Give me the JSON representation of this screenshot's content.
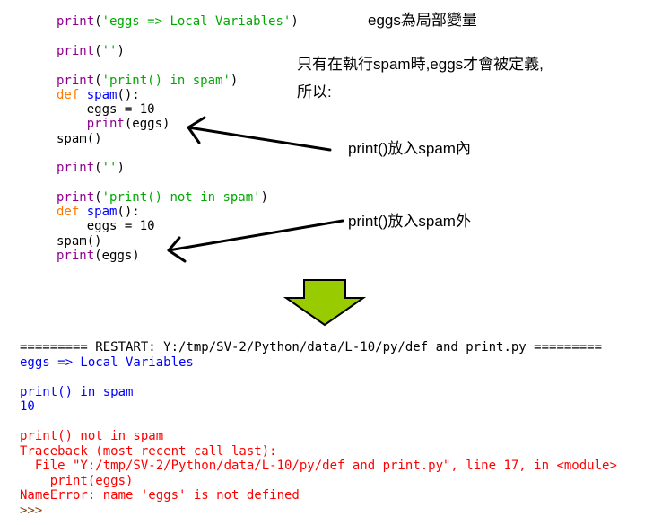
{
  "code": {
    "line1": {
      "fn": "print",
      "open": "(",
      "str": "'eggs => Local Variables'",
      "close": ")"
    },
    "line2": {
      "fn": "print",
      "open": "(",
      "str": "''",
      "close": ")"
    },
    "line3": {
      "fn": "print",
      "open": "(",
      "str": "'print() in spam'",
      "close": ")"
    },
    "line4": {
      "kw": "def",
      "name": "spam",
      "rest": "():"
    },
    "line5": {
      "text": "    eggs = 10"
    },
    "line6": {
      "indent": "    ",
      "fn": "print",
      "rest": "(eggs)"
    },
    "line7": {
      "text": "spam()"
    },
    "line8": {
      "fn": "print",
      "open": "(",
      "str": "''",
      "close": ")"
    },
    "line9": {
      "fn": "print",
      "open": "(",
      "str": "'print() not in spam'",
      "close": ")"
    },
    "line10": {
      "kw": "def",
      "name": "spam",
      "rest": "():"
    },
    "line11": {
      "text": "    eggs = 10"
    },
    "line12": {
      "text": "spam()"
    },
    "line13": {
      "fn": "print",
      "rest": "(eggs)"
    }
  },
  "notes": {
    "local_var": "eggs為局部變量",
    "explain_line1": "只有在執行spam時,eggs才會被定義,",
    "explain_line2": "所以:",
    "print_inside": "print()放入spam內",
    "print_outside": "print()放入spam外"
  },
  "shell": {
    "restart": "========= RESTART: Y:/tmp/SV-2/Python/data/L-10/py/def and print.py =========",
    "out1": "eggs => Local Variables",
    "out2": "print() in spam",
    "out3": "10",
    "out4": "print() not in spam",
    "tb1": "Traceback (most recent call last):",
    "tb2": "  File \"Y:/tmp/SV-2/Python/data/L-10/py/def and print.py\", line 17, in <module>",
    "tb3": "    print(eggs)",
    "tb4": "NameError: name 'eggs' is not defined",
    "prompt": ">>>"
  },
  "colors": {
    "keyword": "#ff7700",
    "builtin": "#900090",
    "string": "#00aa00",
    "defname": "#0000ff",
    "output": "#0000ff",
    "error": "#ff0000",
    "big_arrow_fill": "#99cc00",
    "big_arrow_stroke": "#000000"
  },
  "icons": {
    "big_arrow": "down-arrow-icon",
    "pointer_arrows": "left-arrow-icon"
  }
}
